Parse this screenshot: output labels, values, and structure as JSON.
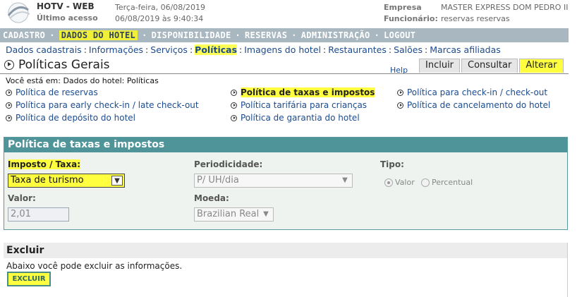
{
  "header": {
    "app_name": "HOTV - WEB",
    "last_access_label": "Último acesso",
    "date_current": "Terça-feira, 06/08/2019",
    "date_last": "06/08/2019  às 9:40:34",
    "company_label": "Empresa",
    "company_value": "MASTER EXPRESS DOM PEDRO II",
    "employee_label": "Funcionário:",
    "employee_value": "reservas reservas"
  },
  "main_nav": {
    "items": [
      "CADASTRO",
      "DADOS DO HOTEL",
      "DISPONIBILIDADE",
      "RESERVAS",
      "ADMINISTRAÇÃO",
      "LOGOUT"
    ],
    "separator": "·",
    "active": "DADOS DO HOTEL"
  },
  "sub_nav": {
    "items": [
      "Dados cadastrais",
      "Informações",
      "Serviços",
      "Políticas",
      "Imagens do hotel",
      "Restaurantes",
      "Salões",
      "Marcas afiliadas"
    ],
    "separator": ":",
    "active": "Políticas"
  },
  "page": {
    "title": "Políticas Gerais",
    "help": "Help",
    "tabs": [
      "Incluir",
      "Consultar",
      "Alterar"
    ],
    "active_tab": "Alterar",
    "breadcrumb": "Você está em: Dados do hotel: Políticas"
  },
  "policies": [
    "Política de reservas",
    "Política de taxas e impostos",
    "Política para check-in / check-out",
    "Política para early check-in / late check-out",
    "Política tarifária para crianças",
    "Política de cancelamento do hotel",
    "Política de depósito do hotel",
    "Política de garantia do hotel"
  ],
  "form": {
    "title": "Política de taxas e impostos",
    "tax_label": "Imposto / Taxa:",
    "tax_value": "Taxa de turismo",
    "period_label": "Periodicidade:",
    "period_value": "P/ UH/dia",
    "type_label": "Tipo:",
    "type_options": [
      "Valor",
      "Percentual"
    ],
    "type_selected": "Valor",
    "value_label": "Valor:",
    "value_value": "2,01",
    "currency_label": "Moeda:",
    "currency_value": "Brazilian Real"
  },
  "delete_section": {
    "title": "Excluir",
    "text": "Abaixo você pode excluir as informações.",
    "button": "EXCLUIR"
  },
  "colors": {
    "highlight": "#ffff40",
    "nav_bar": "#a9b7c0",
    "form_header": "#4f9499",
    "link": "#1b4b8f"
  }
}
